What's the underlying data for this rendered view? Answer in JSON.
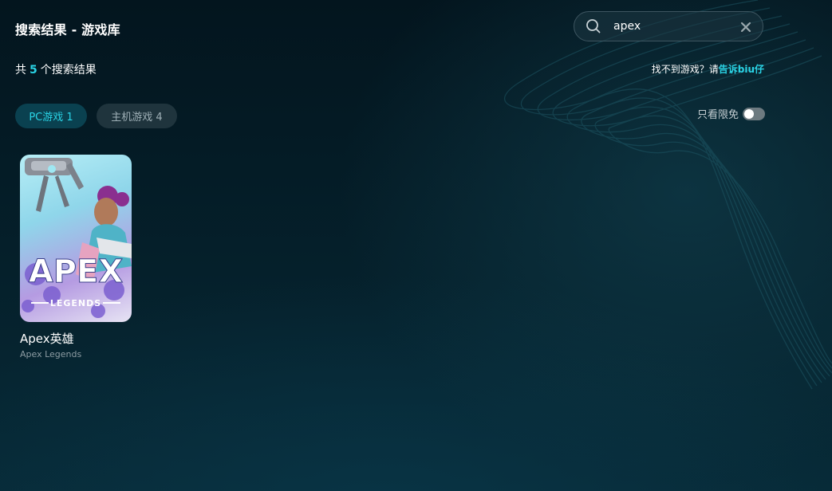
{
  "header": {
    "title": "搜索结果 - 游戏库"
  },
  "search": {
    "value": "apex",
    "icons": {
      "search": "search-icon",
      "clear": "close-icon"
    }
  },
  "results": {
    "prefix": "共",
    "count": "5",
    "suffix": "个搜索结果"
  },
  "help": {
    "text": "找不到游戏？请",
    "link": "告诉biu仔"
  },
  "tabs": [
    {
      "label": "PC游戏 1",
      "active": true
    },
    {
      "label": "主机游戏 4",
      "active": false
    }
  ],
  "filter": {
    "label": "只看限免",
    "on": false
  },
  "games": [
    {
      "name": "Apex英雄",
      "subname": "Apex Legends",
      "cover_logo": "APEX",
      "cover_logo_sub": "LEGENDS"
    }
  ],
  "colors": {
    "accent": "#2ad4e6",
    "background": "#05202b",
    "tab_active_bg": "#0a4150",
    "tab_inactive_bg": "#1f343d"
  }
}
